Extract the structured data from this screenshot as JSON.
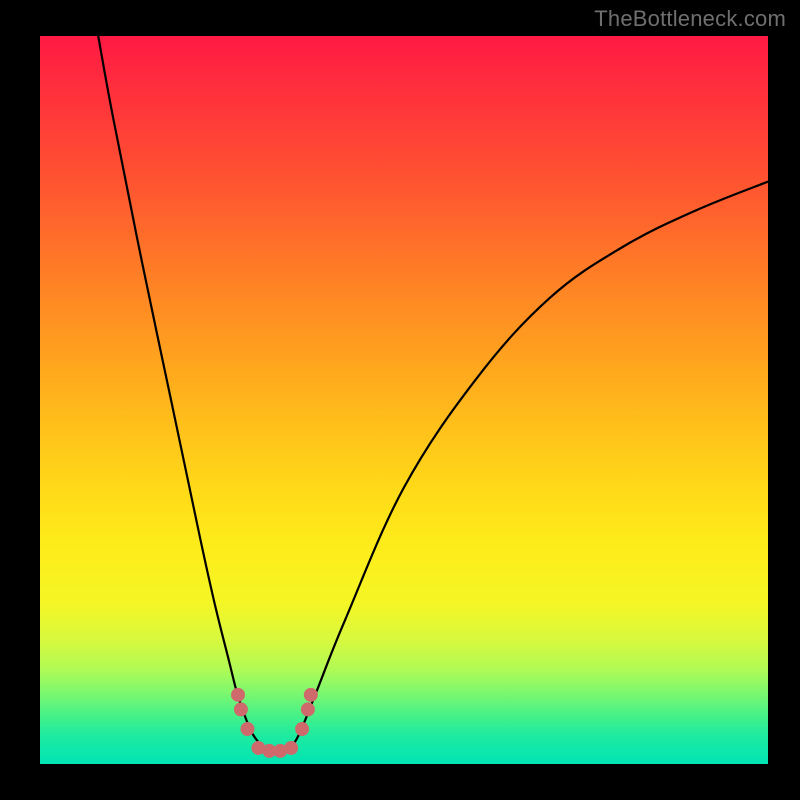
{
  "watermark": "TheBottleneck.com",
  "chart_data": {
    "type": "line",
    "title": "",
    "xlabel": "",
    "ylabel": "",
    "xlim": [
      0,
      100
    ],
    "ylim": [
      0,
      100
    ],
    "grid": false,
    "legend": false,
    "annotations": [],
    "series": [
      {
        "name": "curve",
        "x": [
          8,
          10,
          14,
          18,
          22,
          24,
          26,
          27,
          28,
          29,
          30,
          31,
          32,
          33,
          34,
          35,
          36,
          38,
          42,
          50,
          60,
          70,
          80,
          90,
          100
        ],
        "y": [
          100,
          89,
          69,
          50,
          31,
          22,
          14,
          10,
          7,
          4.5,
          3,
          2,
          1.5,
          1.5,
          2,
          3,
          5,
          10,
          20,
          38,
          53,
          64,
          71,
          76,
          80
        ]
      }
    ],
    "markers": [
      {
        "x": 27.2,
        "y": 9.5
      },
      {
        "x": 27.6,
        "y": 7.5
      },
      {
        "x": 28.5,
        "y": 4.8
      },
      {
        "x": 30.0,
        "y": 2.2
      },
      {
        "x": 31.5,
        "y": 1.8
      },
      {
        "x": 33.0,
        "y": 1.8
      },
      {
        "x": 34.5,
        "y": 2.2
      },
      {
        "x": 36.0,
        "y": 4.8
      },
      {
        "x": 36.8,
        "y": 7.5
      },
      {
        "x": 37.2,
        "y": 9.5
      }
    ],
    "colors": {
      "curve": "#000000",
      "markers": "#cf6a6c",
      "background_top": "#ff1a44",
      "background_bottom": "#00e4b5"
    }
  }
}
